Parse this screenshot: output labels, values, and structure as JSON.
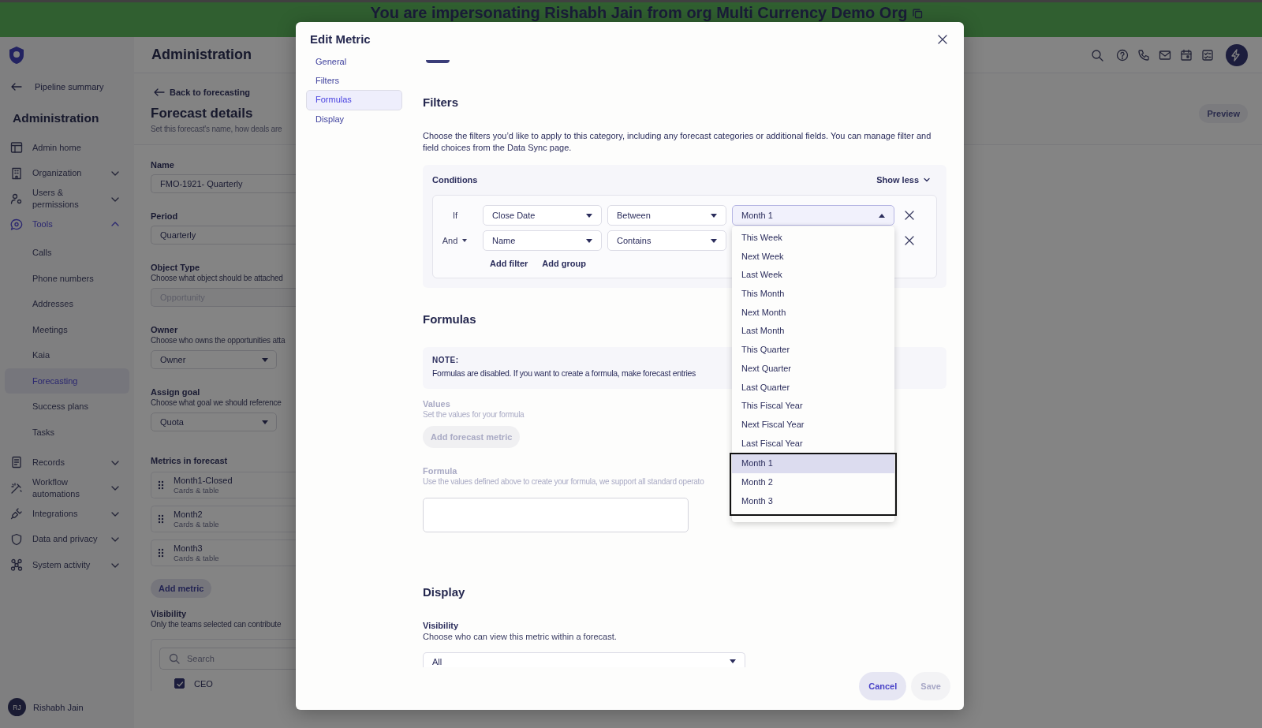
{
  "banner": {
    "text": "You are impersonating Rishabh Jain from org Multi Currency Demo Org"
  },
  "sidebar": {
    "back_link": "Pipeline summary",
    "title": "Administration",
    "items": [
      {
        "label": "Admin home",
        "kind": "link",
        "selected": false
      },
      {
        "label": "Organization",
        "kind": "group",
        "expanded": false,
        "selected": false
      },
      {
        "label": "Users & permissions",
        "kind": "group",
        "expanded": false,
        "selected": false
      },
      {
        "label": "Tools",
        "kind": "group",
        "expanded": true,
        "selected": true,
        "children": [
          {
            "label": "Calls",
            "selected": false
          },
          {
            "label": "Phone numbers",
            "selected": false
          },
          {
            "label": "Addresses",
            "selected": false
          },
          {
            "label": "Meetings",
            "selected": false
          },
          {
            "label": "Kaia",
            "selected": false
          },
          {
            "label": "Forecasting",
            "selected": true
          },
          {
            "label": "Success plans",
            "selected": false
          },
          {
            "label": "Tasks",
            "selected": false
          }
        ]
      },
      {
        "label": "Records",
        "kind": "group",
        "expanded": false,
        "selected": false
      },
      {
        "label": "Workflow automations",
        "kind": "group",
        "expanded": false,
        "selected": false
      },
      {
        "label": "Integrations",
        "kind": "group",
        "expanded": false,
        "selected": false
      },
      {
        "label": "Data and privacy",
        "kind": "group",
        "expanded": false,
        "selected": false
      },
      {
        "label": "System activity",
        "kind": "group",
        "expanded": false,
        "selected": false
      }
    ],
    "user": {
      "initials": "RJ",
      "name": "Rishabh Jain"
    }
  },
  "main": {
    "title": "Administration",
    "back_link": "Back to forecasting",
    "heading": "Forecast details",
    "subtitle": "Set this forecast's name, how deals are",
    "preview_button": "Preview",
    "fields": [
      {
        "kind": "text",
        "label": "Name",
        "value": "FMO-1921- Quarterly",
        "disabled": false
      },
      {
        "kind": "text",
        "label": "Period",
        "value": "Quarterly",
        "disabled": false
      },
      {
        "kind": "text",
        "label": "Object Type",
        "description": "Choose what object should be attached",
        "value": "Opportunity",
        "disabled": true
      },
      {
        "kind": "select",
        "label": "Owner",
        "description": "Choose who owns the opportunities atta",
        "value": "Owner",
        "disabled": false
      },
      {
        "kind": "select",
        "label": "Assign goal",
        "description": "Choose what goal we should reference",
        "value": "Quota",
        "disabled": false
      }
    ],
    "metrics_title": "Metrics in forecast",
    "metrics": [
      {
        "name": "Month1-Closed",
        "type": "Cards & table"
      },
      {
        "name": "Month2",
        "type": "Cards & table"
      },
      {
        "name": "Month3",
        "type": "Cards & table"
      }
    ],
    "add_metric": "Add metric",
    "visibility": {
      "label": "Visibility",
      "description": "Only the teams selected can contribute",
      "search_placeholder": "Search",
      "teams": [
        {
          "label": "CEO",
          "checked": true
        }
      ]
    }
  },
  "modal": {
    "title": "Edit Metric",
    "nav": [
      {
        "label": "General",
        "selected": false
      },
      {
        "label": "Filters",
        "selected": false
      },
      {
        "label": "Formulas",
        "selected": true
      },
      {
        "label": "Display",
        "selected": false
      }
    ],
    "filters": {
      "heading": "Filters",
      "description": "Choose the filters you’d like to apply to this category, including any forecast categories or additional fields. You can manage filter and field choices from the Data Sync page.",
      "conditions": {
        "title": "Conditions",
        "toggle": "Show less",
        "rows": [
          {
            "connector": "If",
            "connector_menu": false,
            "field": "Close Date",
            "operator": "Between",
            "value": "Month 1",
            "value_open": true
          },
          {
            "connector": "And",
            "connector_menu": true,
            "field": "Name",
            "operator": "Contains"
          }
        ],
        "add_filter": "Add filter",
        "add_group": "Add group"
      }
    },
    "dropdown": {
      "options": [
        {
          "label": "This Week",
          "selected": false,
          "focused": false
        },
        {
          "label": "Next Week",
          "selected": false,
          "focused": false
        },
        {
          "label": "Last Week",
          "selected": false,
          "focused": false
        },
        {
          "label": "This Month",
          "selected": false,
          "focused": false
        },
        {
          "label": "Next Month",
          "selected": false,
          "focused": false
        },
        {
          "label": "Last Month",
          "selected": false,
          "focused": false
        },
        {
          "label": "This Quarter",
          "selected": false,
          "focused": false
        },
        {
          "label": "Next Quarter",
          "selected": false,
          "focused": false
        },
        {
          "label": "Last Quarter",
          "selected": false,
          "focused": false
        },
        {
          "label": "This Fiscal Year",
          "selected": false,
          "focused": false
        },
        {
          "label": "Next Fiscal Year",
          "selected": false,
          "focused": false
        },
        {
          "label": "Last Fiscal Year",
          "selected": false,
          "focused": false
        },
        {
          "label": "Month 1",
          "selected": true,
          "focused": true
        },
        {
          "label": "Month 2",
          "selected": false,
          "focused": true
        },
        {
          "label": "Month 3",
          "selected": false,
          "focused": true
        }
      ]
    },
    "formulas": {
      "heading": "Formulas",
      "note_title": "NOTE:",
      "note": "Formulas are disabled. If you want to create a formula, make forecast entries",
      "disabled": true,
      "values_label": "Values",
      "values_hint": "Set the values for your formula",
      "add_button": "Add forecast metric",
      "formula_label": "Formula",
      "formula_hint": "Use the values defined above to create your formula, we support all standard operato"
    },
    "display": {
      "heading": "Display",
      "visibility_label": "Visibility",
      "visibility_hint": "Choose who can view this metric within a forecast.",
      "visibility_value": "All"
    },
    "buttons": [
      {
        "label": "Cancel",
        "disabled": false
      },
      {
        "label": "Save",
        "disabled": true
      }
    ]
  }
}
